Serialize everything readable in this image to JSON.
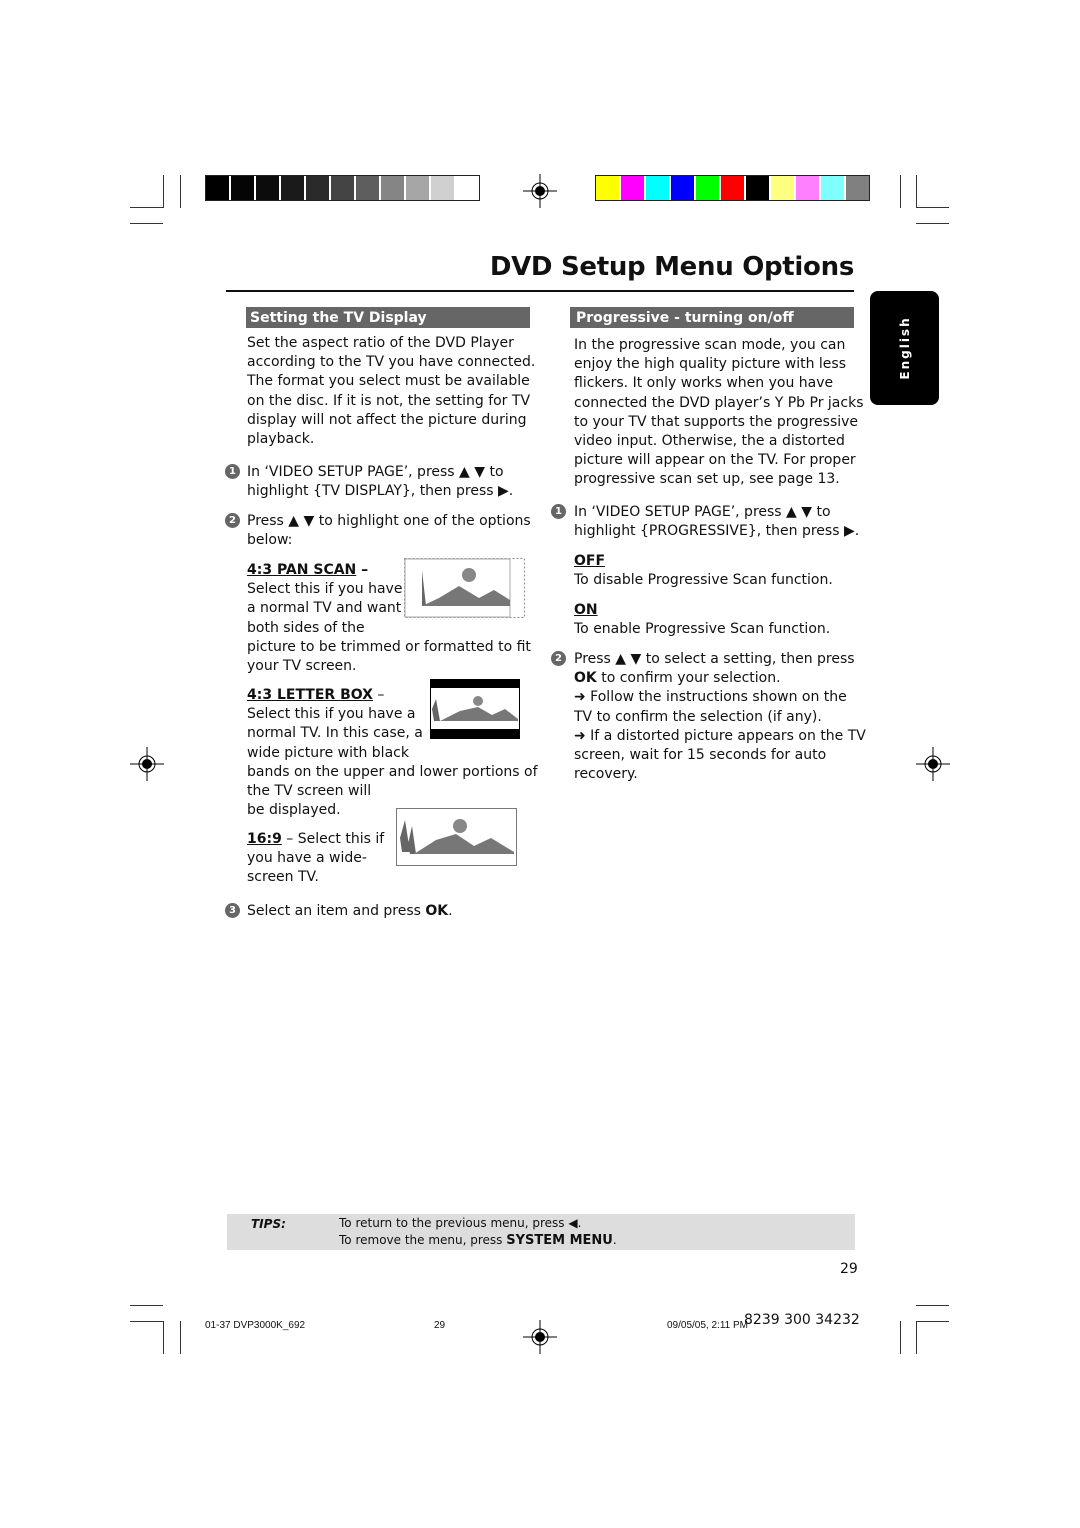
{
  "page_title": "DVD Setup Menu Options",
  "language_tab": "English",
  "calibration": {
    "grayscale": [
      "#000000",
      "#050505",
      "#0c0c0c",
      "#1a1a1a",
      "#2a2a2a",
      "#444444",
      "#5e5e5e",
      "#858585",
      "#a6a6a6",
      "#d0d0d0",
      "#ffffff"
    ],
    "colors": [
      "#ffff00",
      "#ff00ff",
      "#00ffff",
      "#0000ff",
      "#00ff00",
      "#ff0000",
      "#000000",
      "#ffff80",
      "#ff80ff",
      "#80ffff",
      "#808080"
    ]
  },
  "left": {
    "heading": "Setting the TV Display",
    "intro": [
      "Set the aspect ratio of the DVD Player",
      "according to the TV you have connected.",
      "The format you select must be available",
      "on the disc.  If it is not, the setting for TV",
      "display will not affect the picture during",
      "playback."
    ],
    "step1": {
      "num": "1",
      "lines": [
        "In ‘VIDEO SETUP PAGE’, press ▲ ▼ to",
        "highlight {TV DISPLAY}, then press ▶."
      ]
    },
    "step2": {
      "num": "2",
      "lines": [
        "Press ▲ ▼ to highlight one of the options",
        "below:"
      ]
    },
    "pan_scan": {
      "label": "4:3 PAN SCAN",
      "dash": " –",
      "lines": [
        "Select this if you have",
        "a normal TV and want",
        "both sides of the",
        "picture to be trimmed or formatted to fit",
        "your TV screen."
      ]
    },
    "letter_box": {
      "label": "4:3 LETTER BOX",
      "dash": " –",
      "lines": [
        "Select this if you have a",
        "normal TV. In this case, a",
        "wide picture with black",
        "bands on the upper and lower portions of",
        "the TV screen will",
        "be displayed."
      ]
    },
    "wide": {
      "label": "16:9",
      "rest": " – Select this if",
      "lines": [
        "you have a wide-",
        "screen TV."
      ]
    },
    "step3": {
      "num": "3",
      "text": "Select an item and press ",
      "bold": "OK",
      "end": "."
    }
  },
  "right": {
    "heading": "Progressive - turning on/off",
    "intro": [
      "In the progressive scan mode, you can",
      "enjoy the high quality picture with less",
      "flickers.  It only works when you have",
      "connected the DVD player’s Y Pb Pr jacks",
      "to your TV that supports the progressive",
      "video input.  Otherwise, the a distorted",
      "picture will appear on the TV.  For proper",
      "progressive scan set up, see page 13."
    ],
    "step1": {
      "num": "1",
      "lines": [
        "In ‘VIDEO SETUP PAGE’, press ▲ ▼ to",
        "highlight {PROGRESSIVE}, then press ▶."
      ]
    },
    "off": {
      "label": "OFF",
      "desc": "To disable Progressive Scan function."
    },
    "on": {
      "label": "ON",
      "desc": "To enable Progressive Scan function."
    },
    "step2": {
      "num": "2",
      "line1": "Press ▲ ▼ to select a setting, then press",
      "ok": "OK",
      "line2": " to confirm your selection.",
      "arrow1a": "➜ Follow the instructions shown on the",
      "arrow1b": "TV to confirm the selection (if any).",
      "arrow2a": "➜ If a distorted picture appears on the TV",
      "arrow2b": "screen, wait for 15 seconds for auto",
      "arrow2c": "recovery."
    }
  },
  "tips": {
    "label": "TIPS:",
    "line1": "To return to the previous menu, press ◀.",
    "line2_pre": "To remove the menu, press ",
    "line2_bold": "SYSTEM MENU",
    "line2_end": "."
  },
  "page_number": "29",
  "footer": {
    "file": "01-37 DVP3000K_692",
    "page": "29",
    "date": "09/05/05, 2:11 PM",
    "code": "8239 300 34232"
  }
}
